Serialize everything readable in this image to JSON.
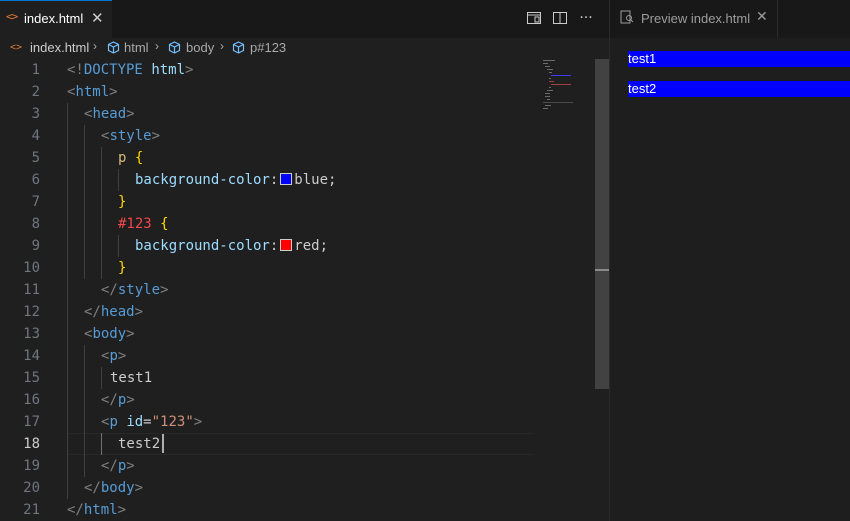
{
  "editor": {
    "tab": {
      "icon": "html-file-icon",
      "label": "index.html"
    },
    "actions": [
      "open-preview-icon",
      "split-editor-icon",
      "more-actions-icon"
    ],
    "breadcrumb": [
      {
        "label": "index.html",
        "icon": "html-file-icon"
      },
      {
        "label": "html",
        "icon": "element-icon"
      },
      {
        "label": "body",
        "icon": "element-icon"
      },
      {
        "label": "p#123",
        "icon": "element-icon"
      }
    ],
    "active_line": 18,
    "line_numbers": [
      "1",
      "2",
      "3",
      "4",
      "5",
      "6",
      "7",
      "8",
      "9",
      "10",
      "11",
      "12",
      "13",
      "14",
      "15",
      "16",
      "17",
      "18",
      "19",
      "20",
      "21"
    ],
    "code": {
      "l1": {
        "open": "<!",
        "doctype": "DOCTYPE",
        "space": " ",
        "kw": "html",
        "close": ">"
      },
      "l2": {
        "lt": "<",
        "tag": "html",
        "gt": ">"
      },
      "l3": {
        "lt": "<",
        "tag": "head",
        "gt": ">"
      },
      "l4": {
        "lt": "<",
        "tag": "style",
        "gt": ">"
      },
      "l5": {
        "selector": "p",
        "brace": "{"
      },
      "l6": {
        "prop": "background-color",
        "colon": ":",
        "value": "blue",
        "semi": ";"
      },
      "l7": {
        "brace": "}"
      },
      "l8": {
        "selector": "#123",
        "brace": "{"
      },
      "l9": {
        "prop": "background-color",
        "colon": ":",
        "value": "red",
        "semi": ";"
      },
      "l10": {
        "brace": "}"
      },
      "l11": {
        "lt": "</",
        "tag": "style",
        "gt": ">"
      },
      "l12": {
        "lt": "</",
        "tag": "head",
        "gt": ">"
      },
      "l13": {
        "lt": "<",
        "tag": "body",
        "gt": ">"
      },
      "l14": {
        "lt": "<",
        "tag": "p",
        "gt": ">"
      },
      "l15": {
        "text": "test1"
      },
      "l16": {
        "lt": "</",
        "tag": "p",
        "gt": ">"
      },
      "l17": {
        "lt": "<",
        "tag": "p",
        "attr": "id",
        "eq": "=",
        "val": "\"123\"",
        "gt": ">"
      },
      "l18": {
        "text": "test2"
      },
      "l19": {
        "lt": "</",
        "tag": "p",
        "gt": ">"
      },
      "l20": {
        "lt": "</",
        "tag": "body",
        "gt": ">"
      },
      "l21": {
        "lt": "</",
        "tag": "html",
        "gt": ">"
      }
    },
    "swatch_colors": {
      "blue": "#0000ff",
      "red": "#ff0000"
    }
  },
  "preview": {
    "tab": {
      "icon": "preview-icon",
      "label": "Preview index.html"
    },
    "paragraphs": [
      {
        "text": "test1",
        "bg": "#0000ff"
      },
      {
        "text": "test2",
        "bg": "#0000ff"
      }
    ]
  }
}
